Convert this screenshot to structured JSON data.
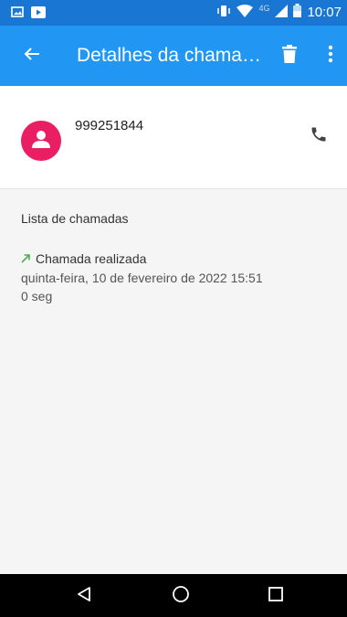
{
  "status_bar": {
    "network_label": "4G",
    "time": "10:07",
    "icons": [
      "gallery-icon",
      "youtube-icon",
      "vibrate-icon",
      "wifi-icon",
      "signal-icon",
      "battery-icon"
    ]
  },
  "app_bar": {
    "title": "Detalhes da chama…",
    "color": "#2196f3",
    "status_color": "#1976d2",
    "icons": [
      "back-arrow-icon",
      "delete-icon",
      "more-vert-icon"
    ]
  },
  "contact": {
    "phone_number": "999251844",
    "avatar_color": "#e91e63",
    "icons": [
      "person-icon",
      "phone-icon"
    ]
  },
  "call_list": {
    "section_title": "Lista de chamadas",
    "entries": [
      {
        "type": "Chamada realizada",
        "datetime": "quinta-feira, 10 de fevereiro de 2022 15:51",
        "duration": "0 seg",
        "icon": "outgoing-call-arrow-icon",
        "icon_color": "#4caf50"
      }
    ]
  },
  "nav_bar": {
    "icons": [
      "back-triangle-icon",
      "home-circle-icon",
      "recents-square-icon"
    ]
  }
}
